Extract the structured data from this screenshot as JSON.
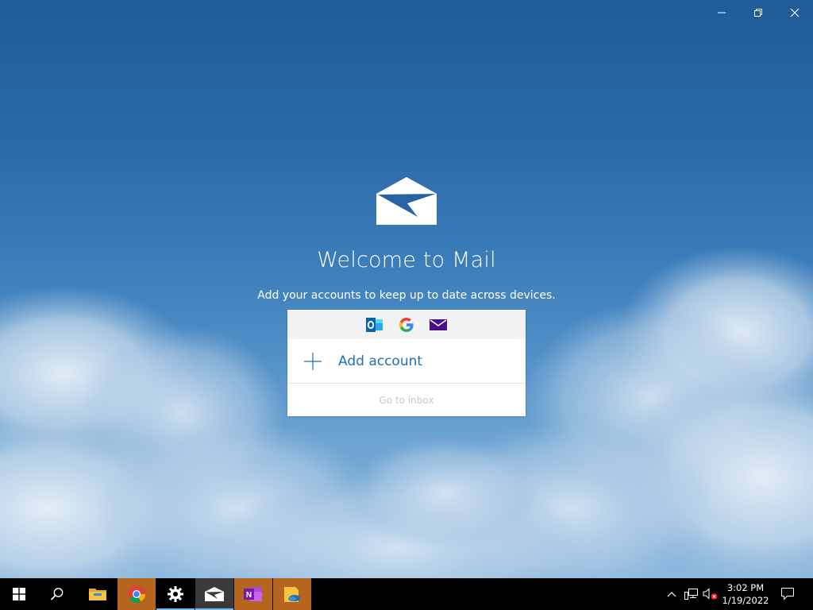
{
  "window": {
    "controls": [
      "minimize",
      "restore",
      "close"
    ]
  },
  "welcome": {
    "title": "Welcome to Mail",
    "subtitle": "Add your accounts to keep up to date across devices.",
    "providers": [
      "outlook-icon",
      "google-icon",
      "mail-envelope-icon"
    ],
    "add_account_label": "Add account",
    "go_to_inbox_label": "Go to inbox"
  },
  "colors": {
    "accent": "#1e6fb6",
    "taskbar_highlight": "#b5651d",
    "sky_top": "#1f5b98"
  },
  "taskbar": {
    "items": [
      "start-icon",
      "search-icon",
      "file-explorer-icon",
      "chrome-icon",
      "settings-icon",
      "mail-icon",
      "onenote-icon",
      "photos-icon"
    ],
    "onenote_letter": "N",
    "tray": [
      "show-hidden-icons-chevron",
      "network-icon",
      "volume-muted-icon"
    ],
    "clock": {
      "time": "3:02 PM",
      "date": "1/19/2022"
    }
  }
}
